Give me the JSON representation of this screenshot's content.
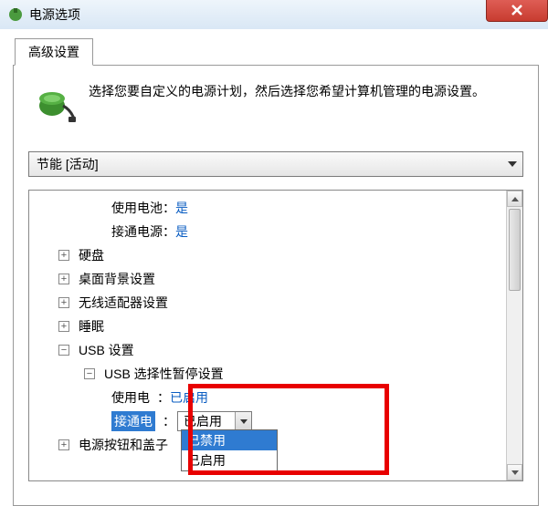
{
  "titlebar": {
    "text": "电源选项"
  },
  "tab": {
    "label": "高级设置"
  },
  "intro": "选择您要自定义的电源计划，然后选择您希望计算机管理的电源设置。",
  "plan_select": {
    "text": "节能 [活动]"
  },
  "rows": {
    "battery_label": "使用电池：",
    "battery_value": "是",
    "ac_label": "接通电源：",
    "ac_value": "是",
    "hdd": "硬盘",
    "desktop_bg": "桌面背景设置",
    "wireless": "无线适配器设置",
    "sleep": "睡眠",
    "usb": "USB 设置",
    "usb_selective": "USB 选择性暂停设置",
    "usb_batt_label": "使用电",
    "usb_batt_suffix": "：",
    "usb_batt_value": "已启用",
    "usb_ac_label": "接通电",
    "usb_ac_suffix": "：",
    "power_btn": "电源按钮和盖子"
  },
  "dropdown": {
    "selected": "已启用",
    "options": [
      "已禁用",
      "已启用"
    ]
  },
  "icons": {
    "plus": "+",
    "minus": "−"
  }
}
